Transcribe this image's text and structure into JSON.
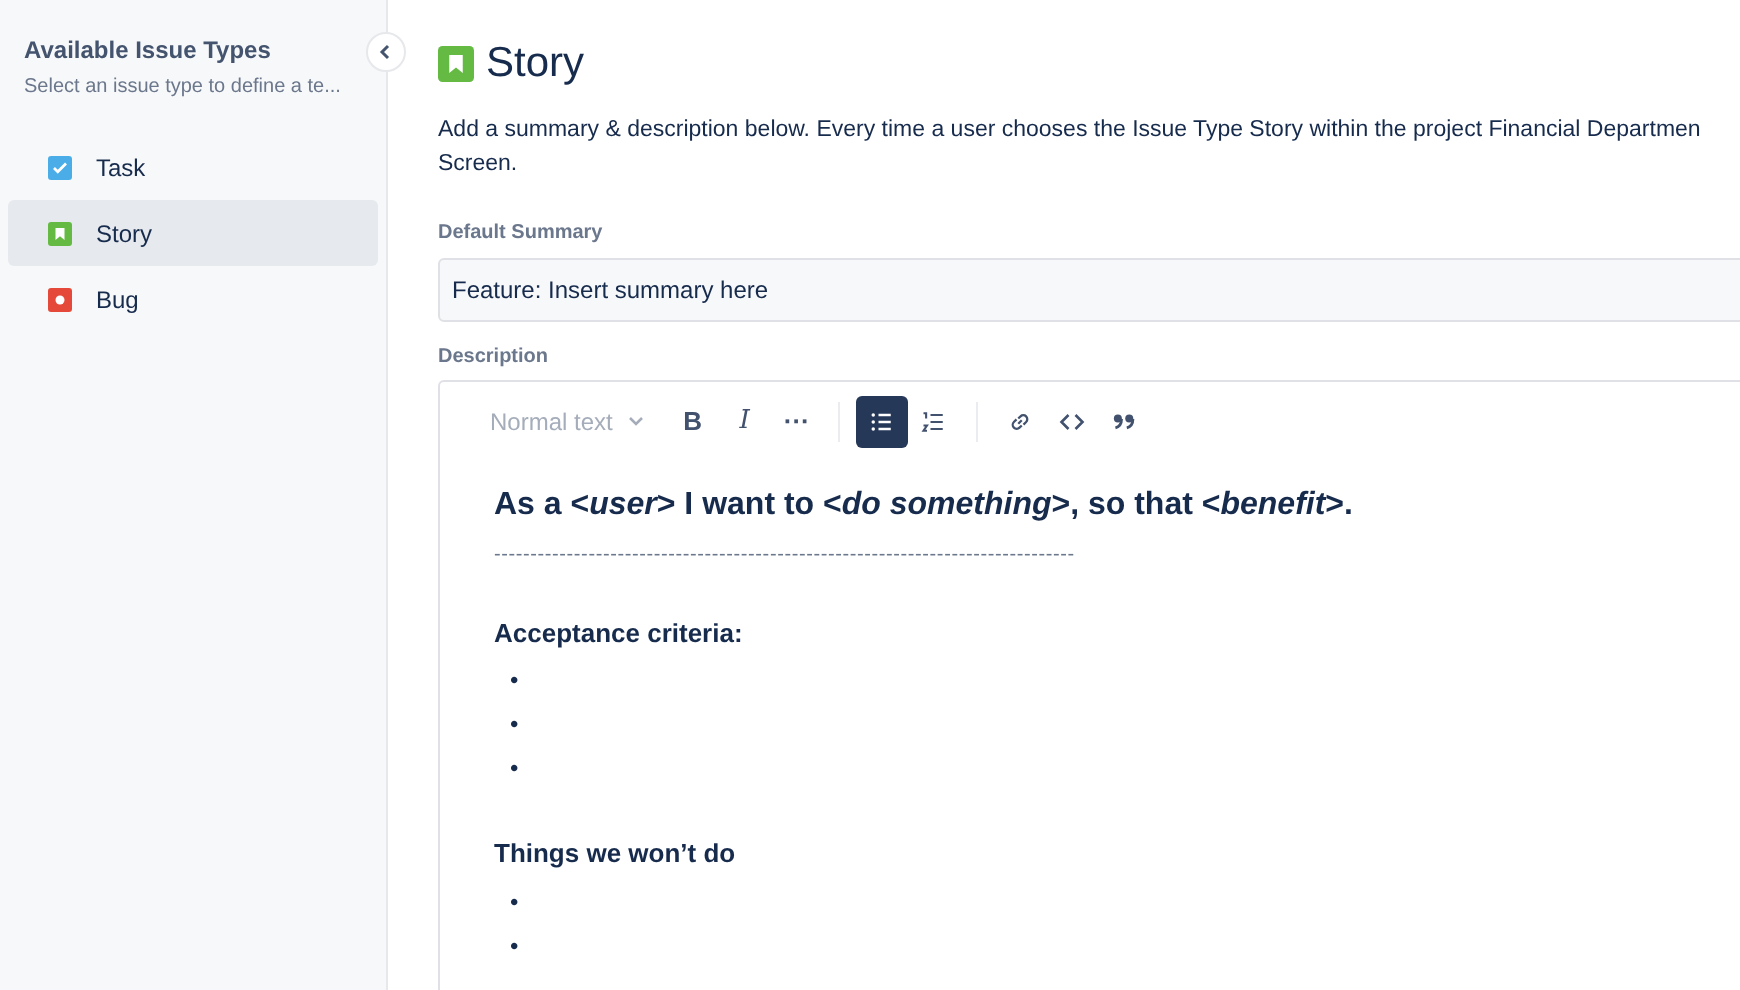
{
  "sidebar": {
    "title": "Available Issue Types",
    "subtitle": "Select an issue type to define a te...",
    "items": [
      {
        "label": "Task",
        "kind": "task",
        "color": "#4bade8",
        "selected": false
      },
      {
        "label": "Story",
        "kind": "story",
        "color": "#65ba43",
        "selected": true
      },
      {
        "label": "Bug",
        "kind": "bug",
        "color": "#e5493a",
        "selected": false
      }
    ]
  },
  "header": {
    "title": "Story",
    "kind": "story"
  },
  "description_lines": [
    "Add a summary & description below. Every time a user chooses the Issue Type Story within the project Financial Departmen",
    "Screen."
  ],
  "summary": {
    "label": "Default Summary",
    "value": "Feature: Insert summary here"
  },
  "editor": {
    "label": "Description",
    "toolbar": [
      {
        "kind": "style",
        "text": "Normal text",
        "selected": false
      },
      {
        "kind": "bold",
        "text": "B",
        "selected": false
      },
      {
        "kind": "italic",
        "text": "I",
        "selected": false
      },
      {
        "kind": "more",
        "text": "···",
        "selected": false
      },
      {
        "kind": "bullets",
        "selected": true
      },
      {
        "kind": "numbers",
        "selected": false
      },
      {
        "kind": "link",
        "selected": false
      },
      {
        "kind": "code",
        "selected": false
      },
      {
        "kind": "quote",
        "selected": false
      }
    ],
    "content": [
      {
        "kind": "heading",
        "text": "As a <*user*> I want to <*do something*>, so that <*benefit*>."
      },
      {
        "kind": "rule",
        "text": "--------------------------------------------------------------------------------"
      },
      {
        "kind": "subheading",
        "text": "Acceptance criteria:"
      },
      {
        "kind": "bullets",
        "bullets": [
          "•",
          "•",
          "•"
        ]
      },
      {
        "kind": "subheading",
        "text": "Things we won’t do"
      },
      {
        "kind": "bullets",
        "bullets": [
          "•",
          "•"
        ]
      }
    ]
  }
}
